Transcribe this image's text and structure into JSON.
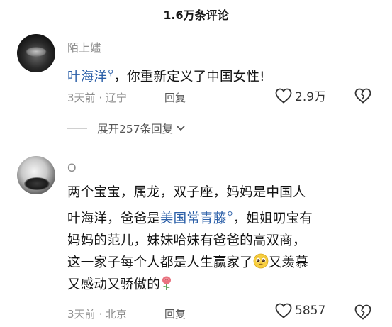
{
  "header": {
    "title": "1.6万条评论"
  },
  "comments": [
    {
      "username": "陌上嫿",
      "text_link": "叶海洋",
      "text_after": "，你重新定义了中国女性!",
      "time": "3天前",
      "location": "辽宁",
      "reply_label": "回复",
      "likes": "2.9万",
      "expand_label": "展开257条回复"
    },
    {
      "username": "O",
      "line1": "两个宝宝，属龙，双子座，妈妈是中国人",
      "line2_before": "叶海洋，爸爸是",
      "line2_link": "美国常青藤",
      "line2_after": "，姐姐叨宝有",
      "line3": "妈妈的范儿，妹妹哈妹有爸爸的高双商，",
      "line4_before": "这一家子每个人都是人生赢家了",
      "line4_after": "又羡慕",
      "line5": "又感动又骄傲的",
      "time": "3天前",
      "location": "北京",
      "reply_label": "回复",
      "likes": "5857"
    }
  ],
  "icons": {
    "search_link": "search-icon",
    "heart": "heart-icon",
    "broken_heart": "broken-heart-icon",
    "chevron": "chevron-down-icon",
    "pleading_emoji": "pleading-face-emoji",
    "rose_emoji": "rose-emoji"
  }
}
